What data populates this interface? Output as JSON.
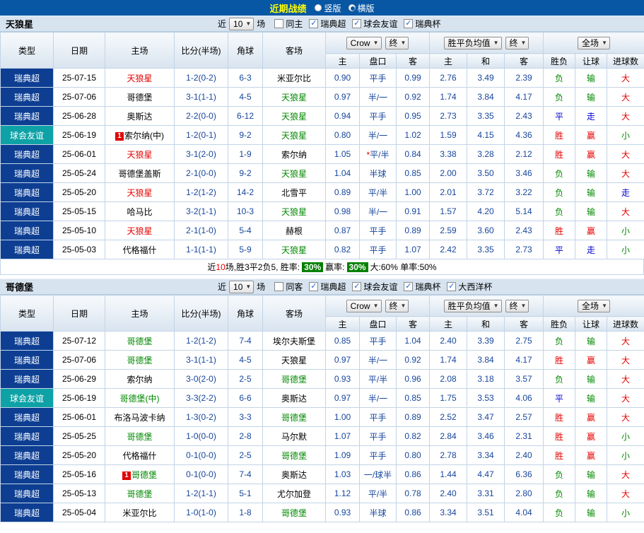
{
  "title_bar": {
    "title": "近期战绩",
    "options": [
      {
        "label": "竖版",
        "selected": false
      },
      {
        "label": "横版",
        "selected": true
      }
    ]
  },
  "table_header": {
    "type": "类型",
    "date": "日期",
    "home": "主场",
    "score": "比分(半场)",
    "corner": "角球",
    "away": "客场",
    "odds_group": {
      "select1": "Crow",
      "select2": "终"
    },
    "mean_group": {
      "select1": "胜平负均值",
      "select2": "终"
    },
    "result_group": {
      "select1": "全场"
    },
    "sub": [
      "主",
      "盘口",
      "客",
      "主",
      "和",
      "客",
      "胜负",
      "让球",
      "进球数"
    ]
  },
  "colors": {
    "header_bar": "#0857a4",
    "title_text": "#ffff00",
    "league_cell": "#0d3e92",
    "friendly_cell": "#0ea2a6",
    "win_red": "#e60000",
    "lose_green": "#008800",
    "draw_blue": "#0000d0",
    "odds_navy": "#16469c"
  },
  "sections": [
    {
      "team": "天狼星",
      "filter": {
        "pre": "近",
        "count": "10",
        "post": "场",
        "checkboxes": [
          {
            "label": "同主",
            "checked": false
          },
          {
            "label": "瑞典超",
            "checked": true
          },
          {
            "label": "球会友谊",
            "checked": true
          },
          {
            "label": "瑞典杯",
            "checked": true
          }
        ]
      },
      "rows": [
        {
          "league": "瑞典超",
          "friendly": false,
          "date": "25-07-15",
          "home": "天狼星",
          "home_color": "red",
          "home_badge": "",
          "score": "1-2(0-2)",
          "corner": "6-3",
          "away": "米亚尔比",
          "away_color": "black",
          "away_badge": "",
          "odds": [
            "0.90",
            "平手",
            "0.99"
          ],
          "mean": [
            "2.76",
            "3.49",
            "2.39"
          ],
          "results": [
            "负",
            "输",
            "大"
          ]
        },
        {
          "league": "瑞典超",
          "friendly": false,
          "date": "25-07-06",
          "home": "哥德堡",
          "home_color": "black",
          "home_badge": "",
          "score": "3-1(1-1)",
          "corner": "4-5",
          "away": "天狼星",
          "away_color": "green",
          "away_badge": "",
          "odds": [
            "0.97",
            "半/一",
            "0.92"
          ],
          "mean": [
            "1.74",
            "3.84",
            "4.17"
          ],
          "results": [
            "负",
            "输",
            "大"
          ]
        },
        {
          "league": "瑞典超",
          "friendly": false,
          "date": "25-06-28",
          "home": "奥斯达",
          "home_color": "black",
          "home_badge": "",
          "score": "2-2(0-0)",
          "corner": "6-12",
          "away": "天狼星",
          "away_color": "green",
          "away_badge": "",
          "odds": [
            "0.94",
            "平手",
            "0.95"
          ],
          "mean": [
            "2.73",
            "3.35",
            "2.43"
          ],
          "results": [
            "平",
            "走",
            "大"
          ]
        },
        {
          "league": "球会友谊",
          "friendly": true,
          "date": "25-06-19",
          "home": "索尔纳(中)",
          "home_color": "black",
          "home_badge": "1",
          "score": "1-2(0-1)",
          "corner": "9-2",
          "away": "天狼星",
          "away_color": "green",
          "away_badge": "",
          "odds": [
            "0.80",
            "半/一",
            "1.02"
          ],
          "mean": [
            "1.59",
            "4.15",
            "4.36"
          ],
          "results": [
            "胜",
            "赢",
            "小"
          ]
        },
        {
          "league": "瑞典超",
          "friendly": false,
          "date": "25-06-01",
          "home": "天狼星",
          "home_color": "red",
          "home_badge": "",
          "score": "3-1(2-0)",
          "corner": "1-9",
          "away": "索尔纳",
          "away_color": "black",
          "away_badge": "",
          "odds": [
            "1.05",
            "*平/半",
            "0.84"
          ],
          "mean": [
            "3.38",
            "3.28",
            "2.12"
          ],
          "results": [
            "胜",
            "赢",
            "大"
          ]
        },
        {
          "league": "瑞典超",
          "friendly": false,
          "date": "25-05-24",
          "home": "哥德堡盖斯",
          "home_color": "black",
          "home_badge": "",
          "score": "2-1(0-0)",
          "corner": "9-2",
          "away": "天狼星",
          "away_color": "green",
          "away_badge": "",
          "odds": [
            "1.04",
            "半球",
            "0.85"
          ],
          "mean": [
            "2.00",
            "3.50",
            "3.46"
          ],
          "results": [
            "负",
            "输",
            "大"
          ]
        },
        {
          "league": "瑞典超",
          "friendly": false,
          "date": "25-05-20",
          "home": "天狼星",
          "home_color": "red",
          "home_badge": "",
          "score": "1-2(1-2)",
          "corner": "14-2",
          "away": "北雪平",
          "away_color": "black",
          "away_badge": "",
          "odds": [
            "0.89",
            "平/半",
            "1.00"
          ],
          "mean": [
            "2.01",
            "3.72",
            "3.22"
          ],
          "results": [
            "负",
            "输",
            "走"
          ]
        },
        {
          "league": "瑞典超",
          "friendly": false,
          "date": "25-05-15",
          "home": "哈马比",
          "home_color": "black",
          "home_badge": "",
          "score": "3-2(1-1)",
          "corner": "10-3",
          "away": "天狼星",
          "away_color": "green",
          "away_badge": "",
          "odds": [
            "0.98",
            "半/一",
            "0.91"
          ],
          "mean": [
            "1.57",
            "4.20",
            "5.14"
          ],
          "results": [
            "负",
            "输",
            "大"
          ]
        },
        {
          "league": "瑞典超",
          "friendly": false,
          "date": "25-05-10",
          "home": "天狼星",
          "home_color": "red",
          "home_badge": "",
          "score": "2-1(1-0)",
          "corner": "5-4",
          "away": "赫根",
          "away_color": "black",
          "away_badge": "",
          "odds": [
            "0.87",
            "平手",
            "0.89"
          ],
          "mean": [
            "2.59",
            "3.60",
            "2.43"
          ],
          "results": [
            "胜",
            "赢",
            "小"
          ]
        },
        {
          "league": "瑞典超",
          "friendly": false,
          "date": "25-05-03",
          "home": "代格福什",
          "home_color": "black",
          "home_badge": "",
          "score": "1-1(1-1)",
          "corner": "5-9",
          "away": "天狼星",
          "away_color": "green",
          "away_badge": "",
          "odds": [
            "0.82",
            "平手",
            "1.07"
          ],
          "mean": [
            "2.42",
            "3.35",
            "2.73"
          ],
          "results": [
            "平",
            "走",
            "小"
          ]
        }
      ],
      "summary": [
        {
          "text": "近"
        },
        {
          "text": "10",
          "color": "red"
        },
        {
          "text": "场,胜3平2负5, 胜率: "
        },
        {
          "text": "30%",
          "badge": true
        },
        {
          "text": " 赢率: "
        },
        {
          "text": "30%",
          "badge": true
        },
        {
          "text": " 大:60% 单率:50%"
        }
      ]
    },
    {
      "team": "哥德堡",
      "filter": {
        "pre": "近",
        "count": "10",
        "post": "场",
        "checkboxes": [
          {
            "label": "同客",
            "checked": false
          },
          {
            "label": "瑞典超",
            "checked": true
          },
          {
            "label": "球会友谊",
            "checked": true
          },
          {
            "label": "瑞典杯",
            "checked": true
          },
          {
            "label": "大西洋杯",
            "checked": true
          }
        ]
      },
      "rows": [
        {
          "league": "瑞典超",
          "friendly": false,
          "date": "25-07-12",
          "home": "哥德堡",
          "home_color": "green",
          "home_badge": "",
          "score": "1-2(1-2)",
          "corner": "7-4",
          "away": "埃尔夫斯堡",
          "away_color": "black",
          "away_badge": "",
          "odds": [
            "0.85",
            "平手",
            "1.04"
          ],
          "mean": [
            "2.40",
            "3.39",
            "2.75"
          ],
          "results": [
            "负",
            "输",
            "大"
          ]
        },
        {
          "league": "瑞典超",
          "friendly": false,
          "date": "25-07-06",
          "home": "哥德堡",
          "home_color": "green",
          "home_badge": "",
          "score": "3-1(1-1)",
          "corner": "4-5",
          "away": "天狼星",
          "away_color": "black",
          "away_badge": "",
          "odds": [
            "0.97",
            "半/一",
            "0.92"
          ],
          "mean": [
            "1.74",
            "3.84",
            "4.17"
          ],
          "results": [
            "胜",
            "赢",
            "大"
          ]
        },
        {
          "league": "瑞典超",
          "friendly": false,
          "date": "25-06-29",
          "home": "索尔纳",
          "home_color": "black",
          "home_badge": "",
          "score": "3-0(2-0)",
          "corner": "2-5",
          "away": "哥德堡",
          "away_color": "green",
          "away_badge": "",
          "odds": [
            "0.93",
            "平/半",
            "0.96"
          ],
          "mean": [
            "2.08",
            "3.18",
            "3.57"
          ],
          "results": [
            "负",
            "输",
            "大"
          ]
        },
        {
          "league": "球会友谊",
          "friendly": true,
          "date": "25-06-19",
          "home": "哥德堡(中)",
          "home_color": "green",
          "home_badge": "",
          "score": "3-3(2-2)",
          "corner": "6-6",
          "away": "奥斯达",
          "away_color": "black",
          "away_badge": "",
          "odds": [
            "0.97",
            "半/一",
            "0.85"
          ],
          "mean": [
            "1.75",
            "3.53",
            "4.06"
          ],
          "results": [
            "平",
            "输",
            "大"
          ]
        },
        {
          "league": "瑞典超",
          "friendly": false,
          "date": "25-06-01",
          "home": "布洛马波卡纳",
          "home_color": "black",
          "home_badge": "",
          "score": "1-3(0-2)",
          "corner": "3-3",
          "away": "哥德堡",
          "away_color": "green",
          "away_badge": "",
          "odds": [
            "1.00",
            "平手",
            "0.89"
          ],
          "mean": [
            "2.52",
            "3.47",
            "2.57"
          ],
          "results": [
            "胜",
            "赢",
            "大"
          ]
        },
        {
          "league": "瑞典超",
          "friendly": false,
          "date": "25-05-25",
          "home": "哥德堡",
          "home_color": "green",
          "home_badge": "",
          "score": "1-0(0-0)",
          "corner": "2-8",
          "away": "马尔默",
          "away_color": "black",
          "away_badge": "",
          "odds": [
            "1.07",
            "平手",
            "0.82"
          ],
          "mean": [
            "2.84",
            "3.46",
            "2.31"
          ],
          "results": [
            "胜",
            "赢",
            "小"
          ]
        },
        {
          "league": "瑞典超",
          "friendly": false,
          "date": "25-05-20",
          "home": "代格福什",
          "home_color": "black",
          "home_badge": "",
          "score": "0-1(0-0)",
          "corner": "2-5",
          "away": "哥德堡",
          "away_color": "green",
          "away_badge": "",
          "odds": [
            "1.09",
            "平手",
            "0.80"
          ],
          "mean": [
            "2.78",
            "3.34",
            "2.40"
          ],
          "results": [
            "胜",
            "赢",
            "小"
          ]
        },
        {
          "league": "瑞典超",
          "friendly": false,
          "date": "25-05-16",
          "home": "哥德堡",
          "home_color": "green",
          "home_badge": "1",
          "score": "0-1(0-0)",
          "corner": "7-4",
          "away": "奥斯达",
          "away_color": "black",
          "away_badge": "",
          "odds": [
            "1.03",
            "一/球半",
            "0.86"
          ],
          "mean": [
            "1.44",
            "4.47",
            "6.36"
          ],
          "results": [
            "负",
            "输",
            "大"
          ]
        },
        {
          "league": "瑞典超",
          "friendly": false,
          "date": "25-05-13",
          "home": "哥德堡",
          "home_color": "green",
          "home_badge": "",
          "score": "1-2(1-1)",
          "corner": "5-1",
          "away": "尤尔加登",
          "away_color": "black",
          "away_badge": "",
          "odds": [
            "1.12",
            "平/半",
            "0.78"
          ],
          "mean": [
            "2.40",
            "3.31",
            "2.80"
          ],
          "results": [
            "负",
            "输",
            "大"
          ]
        },
        {
          "league": "瑞典超",
          "friendly": false,
          "date": "25-05-04",
          "home": "米亚尔比",
          "home_color": "black",
          "home_badge": "",
          "score": "1-0(1-0)",
          "corner": "1-8",
          "away": "哥德堡",
          "away_color": "green",
          "away_badge": "",
          "odds": [
            "0.93",
            "半球",
            "0.86"
          ],
          "mean": [
            "3.34",
            "3.51",
            "4.04"
          ],
          "results": [
            "负",
            "输",
            "小"
          ]
        }
      ],
      "summary": null
    }
  ]
}
